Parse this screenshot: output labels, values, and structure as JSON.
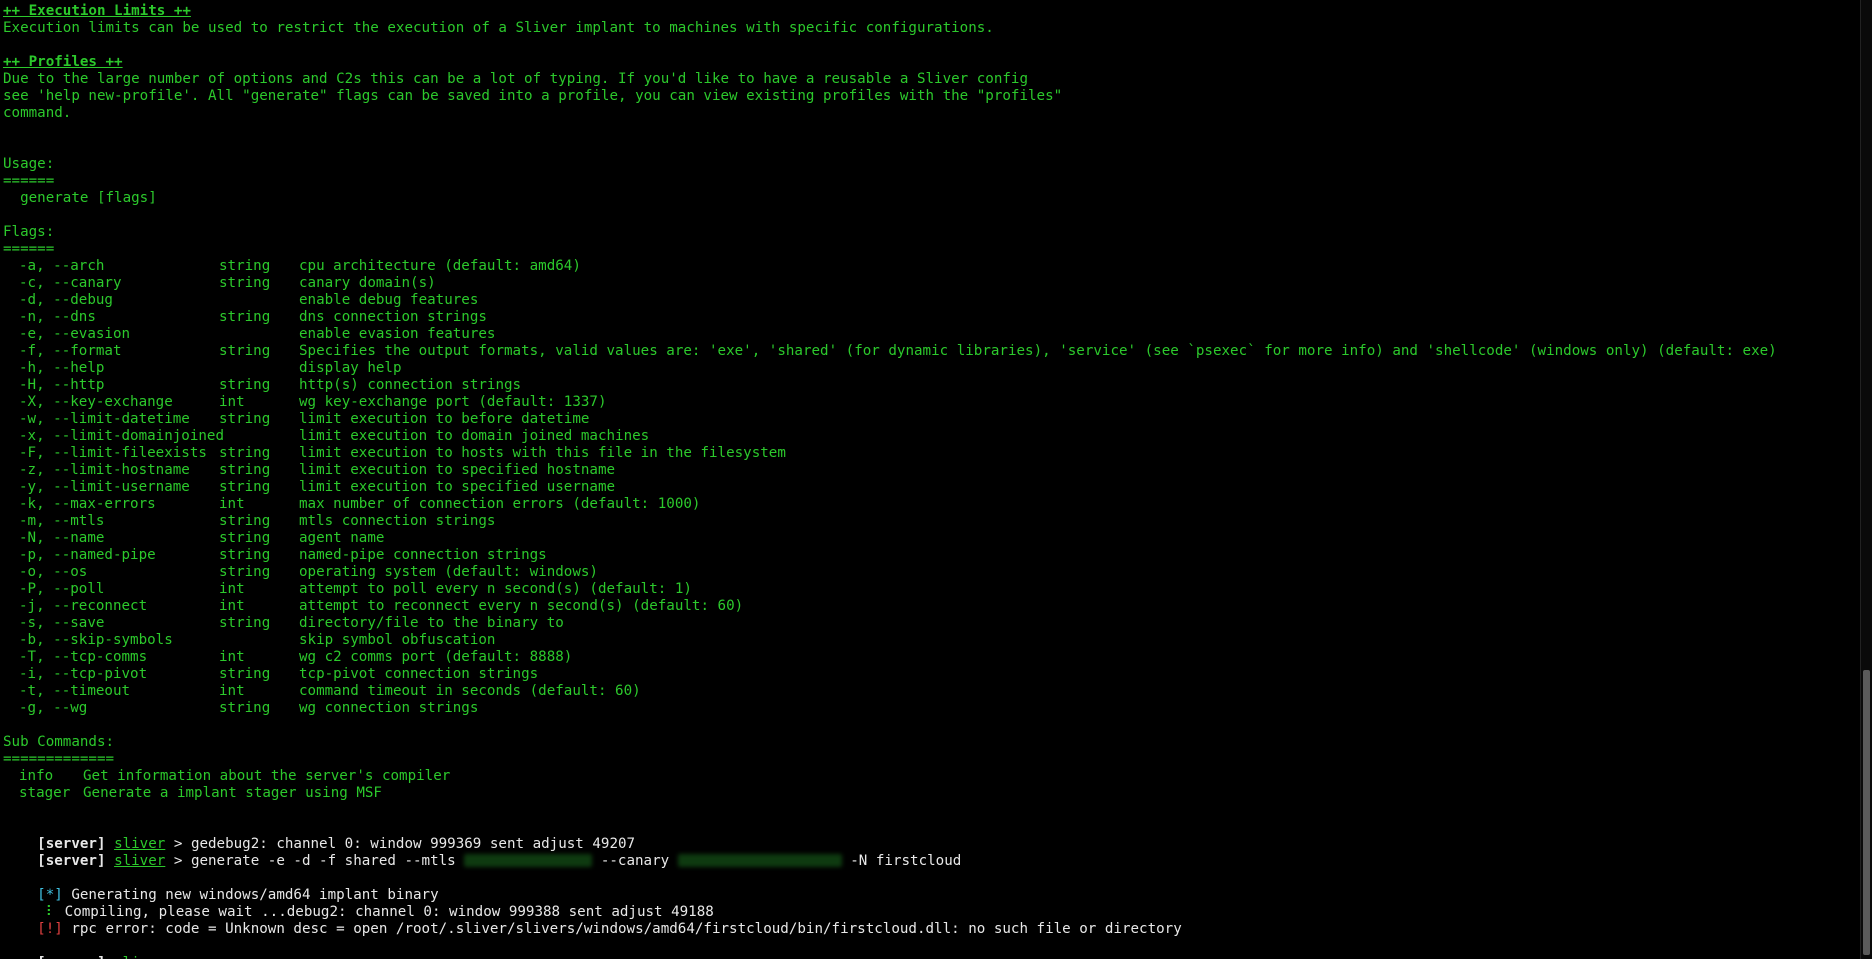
{
  "exec_limits": {
    "heading": "++ Execution Limits ++",
    "text": "Execution limits can be used to restrict the execution of a Sliver implant to machines with specific configurations."
  },
  "profiles": {
    "heading": "++ Profiles ++",
    "line1": "Due to the large number of options and C2s this can be a lot of typing. If you'd like to have a reusable a Sliver config",
    "line2": "see 'help new-profile'. All \"generate\" flags can be saved into a profile, you can view existing profiles with the \"profiles\"",
    "line3": "command."
  },
  "usage": {
    "title": "Usage:",
    "rule": "======",
    "command": "  generate [flags]"
  },
  "flags": {
    "title": "Flags:",
    "rule": "======",
    "rows": [
      {
        "name": "-a, --arch",
        "type": "string",
        "desc": "cpu architecture (default: amd64)"
      },
      {
        "name": "-c, --canary",
        "type": "string",
        "desc": "canary domain(s)"
      },
      {
        "name": "-d, --debug",
        "type": "",
        "desc": "enable debug features"
      },
      {
        "name": "-n, --dns",
        "type": "string",
        "desc": "dns connection strings"
      },
      {
        "name": "-e, --evasion",
        "type": "",
        "desc": "enable evasion features"
      },
      {
        "name": "-f, --format",
        "type": "string",
        "desc": "Specifies the output formats, valid values are: 'exe', 'shared' (for dynamic libraries), 'service' (see `psexec` for more info) and 'shellcode' (windows only) (default: exe)"
      },
      {
        "name": "-h, --help",
        "type": "",
        "desc": "display help"
      },
      {
        "name": "-H, --http",
        "type": "string",
        "desc": "http(s) connection strings"
      },
      {
        "name": "-X, --key-exchange",
        "type": "int",
        "desc": "wg key-exchange port (default: 1337)"
      },
      {
        "name": "-w, --limit-datetime",
        "type": "string",
        "desc": "limit execution to before datetime"
      },
      {
        "name": "-x, --limit-domainjoined",
        "type": "",
        "desc": "limit execution to domain joined machines"
      },
      {
        "name": "-F, --limit-fileexists",
        "type": "string",
        "desc": "limit execution to hosts with this file in the filesystem"
      },
      {
        "name": "-z, --limit-hostname",
        "type": "string",
        "desc": "limit execution to specified hostname"
      },
      {
        "name": "-y, --limit-username",
        "type": "string",
        "desc": "limit execution to specified username"
      },
      {
        "name": "-k, --max-errors",
        "type": "int",
        "desc": "max number of connection errors (default: 1000)"
      },
      {
        "name": "-m, --mtls",
        "type": "string",
        "desc": "mtls connection strings"
      },
      {
        "name": "-N, --name",
        "type": "string",
        "desc": "agent name"
      },
      {
        "name": "-p, --named-pipe",
        "type": "string",
        "desc": "named-pipe connection strings"
      },
      {
        "name": "-o, --os",
        "type": "string",
        "desc": "operating system (default: windows)"
      },
      {
        "name": "-P, --poll",
        "type": "int",
        "desc": "attempt to poll every n second(s) (default: 1)"
      },
      {
        "name": "-j, --reconnect",
        "type": "int",
        "desc": "attempt to reconnect every n second(s) (default: 60)"
      },
      {
        "name": "-s, --save",
        "type": "string",
        "desc": "directory/file to the binary to"
      },
      {
        "name": "-b, --skip-symbols",
        "type": "",
        "desc": "skip symbol obfuscation"
      },
      {
        "name": "-T, --tcp-comms",
        "type": "int",
        "desc": "wg c2 comms port (default: 8888)"
      },
      {
        "name": "-i, --tcp-pivot",
        "type": "string",
        "desc": "tcp-pivot connection strings"
      },
      {
        "name": "-t, --timeout",
        "type": "int",
        "desc": "command timeout in seconds (default: 60)"
      },
      {
        "name": "-g, --wg",
        "type": "string",
        "desc": "wg connection strings"
      }
    ]
  },
  "subcommands": {
    "title": "Sub Commands:",
    "rule": "=============",
    "rows": [
      {
        "name": "info",
        "desc": "Get information about the server's compiler"
      },
      {
        "name": "stager",
        "desc": "Generate a implant stager using MSF"
      }
    ]
  },
  "prompt": {
    "server": "[server]",
    "context": "sliver",
    "arrow": " > "
  },
  "session": {
    "cmd1": "gedebug2: channel 0: window 999369 sent adjust 49207",
    "cmd2_a": "generate -e -d -f shared --mtls ",
    "cmd2_b": " --canary ",
    "cmd2_c": " -N firstcloud",
    "gen_prefix": "[*]",
    "gen_text": " Generating new windows/amd64 implant binary",
    "spinner": " ⠇",
    "compile_text": " Compiling, please wait ...debug2: channel 0: window 999388 sent adjust 49188",
    "err_prefix": "[!]",
    "err_text": " rpc error: code = Unknown desc = open /root/.sliver/slivers/windows/amd64/firstcloud/bin/firstcloud.dll: no such file or directory"
  }
}
